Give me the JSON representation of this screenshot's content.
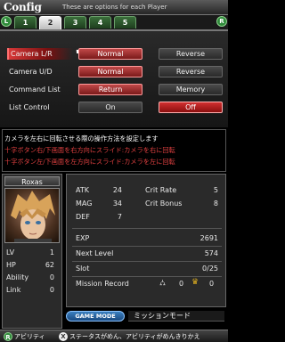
{
  "header": {
    "title": "Config",
    "tip": "These are options for each Player"
  },
  "tabs": {
    "shoulder_left": "L",
    "shoulder_right": "R",
    "items": [
      "1",
      "2",
      "3",
      "4",
      "5"
    ],
    "active_index": 1
  },
  "options": [
    {
      "label": "Camera L/R",
      "choice_a": "Normal",
      "choice_b": "Reverse",
      "selected": "a"
    },
    {
      "label": "Camera U/D",
      "choice_a": "Normal",
      "choice_b": "Reverse",
      "selected": "a"
    },
    {
      "label": "Command List",
      "choice_a": "Return",
      "choice_b": "Memory",
      "selected": "a"
    },
    {
      "label": "List Control",
      "choice_a": "On",
      "choice_b": "Off",
      "selected": "b"
    }
  ],
  "description": {
    "line1": "カメラを左右に回転させる際の操作方法を設定します",
    "line2": "十字ボタン右/下画面を右方向にスライド:カメラを右に回転",
    "line3": "十字ボタン左/下画面を左方向にスライド:カメラを左に回転"
  },
  "character": {
    "name": "Roxas",
    "lv_label": "LV",
    "lv": "1",
    "hp_label": "HP",
    "hp": "62",
    "ability_label": "Ability",
    "ability": "0",
    "link_label": "Link",
    "link": "0"
  },
  "stats": {
    "atk_label": "ATK",
    "atk": "24",
    "mag_label": "MAG",
    "mag": "34",
    "def_label": "DEF",
    "def": "7",
    "crit_rate_label": "Crit Rate",
    "crit_rate": "5",
    "crit_bonus_label": "Crit Bonus",
    "crit_bonus": "8",
    "exp_label": "EXP",
    "exp": "2691",
    "next_level_label": "Next Level",
    "next_level": "574",
    "slot_label": "Slot",
    "slot": "0/25",
    "mission_label": "Mission Record",
    "mission_a": "0",
    "mission_b": "0"
  },
  "game_mode": {
    "label": "GAME MODE",
    "value": "ミッションモード"
  },
  "bottom_bar": {
    "r_button": "R",
    "r_label": "アビリティ",
    "x_button": "X",
    "x_label": "ステータスがめん、アビリティがめんきりかえ"
  },
  "colors": {
    "accent_red": "#c04848",
    "tab_green": "#3a6e3a",
    "panel_bg": "#2a2a2a"
  }
}
